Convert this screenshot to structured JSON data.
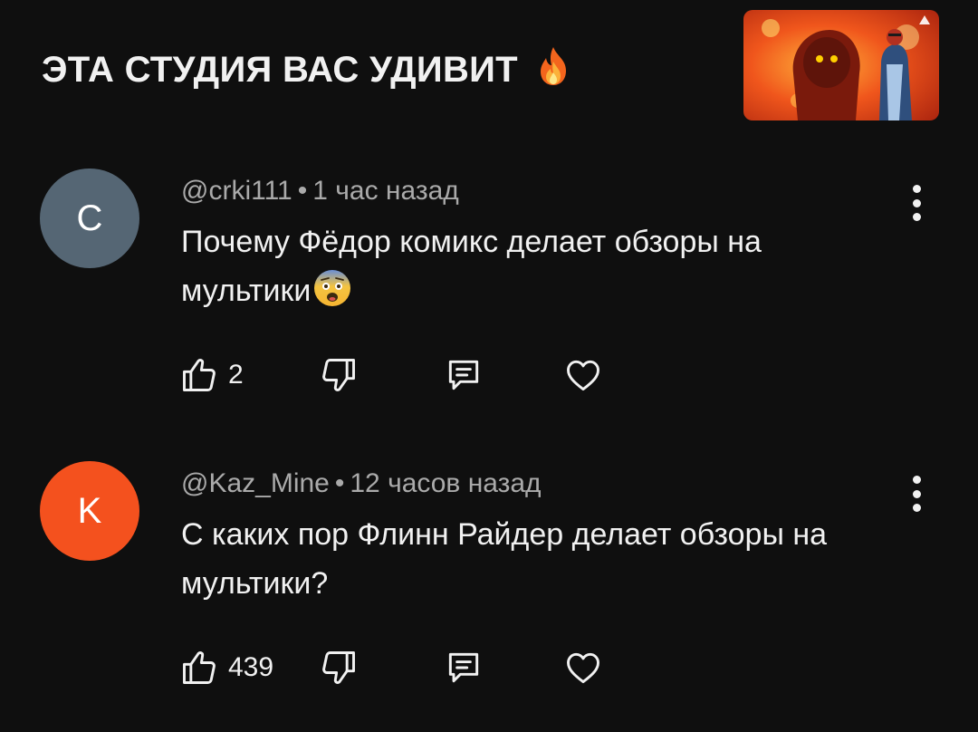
{
  "video": {
    "title": "ЭТА СТУДИЯ ВАС УДИВИТ",
    "title_emoji": "fire-emoji"
  },
  "comments": [
    {
      "avatar_letter": "C",
      "avatar_color": "#556674",
      "author": "@crki111",
      "time": "1 час назад",
      "text": "Почему Фёдор комикс делает обзоры на мультики",
      "emoji": "fearful-face-emoji",
      "likes": "2"
    },
    {
      "avatar_letter": "K",
      "avatar_color": "#f4511e",
      "author": "@Kaz_Mine",
      "time": "12 часов назад",
      "text": "С каких пор Флинн Райдер делает обзоры на мультики?",
      "likes": "439"
    }
  ],
  "meta_separator": "•",
  "colors": {
    "background": "#0f0f0f",
    "primary_text": "#f1f1f1",
    "secondary_text": "#aaaaaa"
  },
  "icons": {
    "like": "thumb-up-icon",
    "dislike": "thumb-down-icon",
    "reply": "comment-bubble-icon",
    "heart": "heart-icon",
    "more": "more-vertical-icon"
  }
}
